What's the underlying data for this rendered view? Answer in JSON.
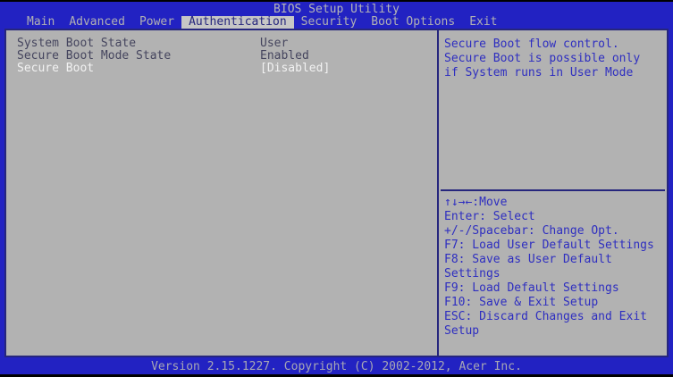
{
  "title": "BIOS Setup Utility",
  "menu": {
    "items": [
      {
        "label": "Main",
        "name": "tab-main",
        "selected": false
      },
      {
        "label": "Advanced",
        "name": "tab-advanced",
        "selected": false
      },
      {
        "label": "Power",
        "name": "tab-power",
        "selected": false
      },
      {
        "label": "Authentication",
        "name": "tab-authentication",
        "selected": true
      },
      {
        "label": "Security",
        "name": "tab-security",
        "selected": false
      },
      {
        "label": "Boot Options",
        "name": "tab-boot-options",
        "selected": false
      },
      {
        "label": "Exit",
        "name": "tab-exit",
        "selected": false
      }
    ]
  },
  "settings": {
    "rows": [
      {
        "label": "System Boot State",
        "value": "User",
        "name": "setting-row-system-boot-state",
        "selected": false,
        "interactable": false
      },
      {
        "label": "Secure Boot Mode State",
        "value": "Enabled",
        "name": "setting-row-secure-boot-mode-state",
        "selected": false,
        "interactable": false
      },
      {
        "label": "Secure Boot",
        "value": "[Disabled]",
        "name": "setting-row-secure-boot",
        "selected": true,
        "interactable": true
      }
    ]
  },
  "help": {
    "lines": [
      "Secure Boot flow control.",
      "Secure Boot is possible only",
      "if System runs in User Mode"
    ]
  },
  "hints": {
    "lines": [
      "↑↓→←:Move",
      "Enter: Select",
      "+/-/Spacebar: Change Opt.",
      "F7: Load User Default Settings",
      "F8: Save as User Default Settings",
      "F9: Load Default Settings",
      "F10: Save & Exit Setup",
      "ESC: Discard Changes and Exit Setup"
    ]
  },
  "footer": {
    "text": "Version 2.15.1227. Copyright (C) 2002-2012, Acer Inc."
  },
  "colors": {
    "screen_blue": "#2222c2",
    "panel_gray": "#b2b2b2",
    "border_navy": "#26267d",
    "help_text_blue": "#2e2ec0",
    "item_text_navy": "#45455e",
    "selected_item_text": "#f2f2f2",
    "selected_tab_bg": "#c6c6c6",
    "bar_text_gray": "#b6b6b6"
  }
}
